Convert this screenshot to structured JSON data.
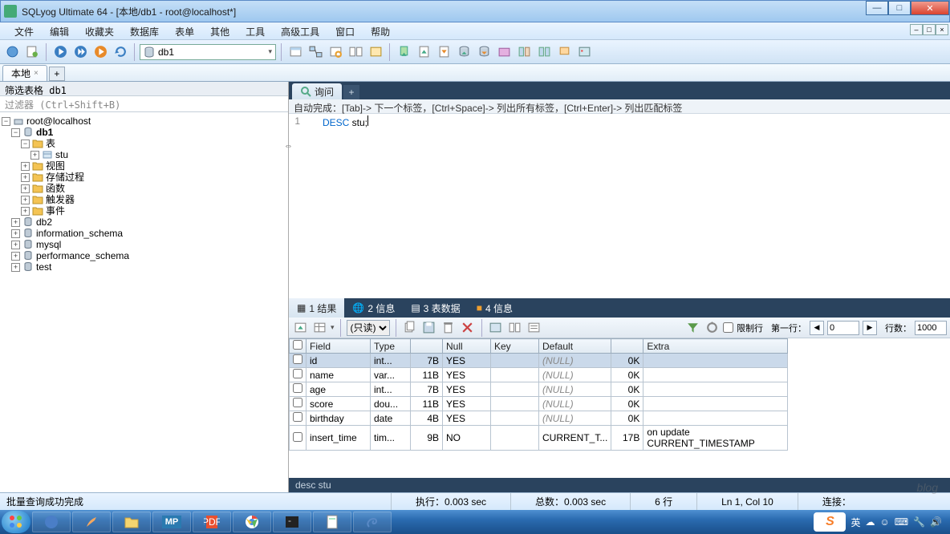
{
  "window": {
    "title": "SQLyog Ultimate 64 - [本地/db1 - root@localhost*]"
  },
  "menu": {
    "items": [
      "文件",
      "编辑",
      "收藏夹",
      "数据库",
      "表单",
      "其他",
      "工具",
      "高级工具",
      "窗口",
      "帮助"
    ]
  },
  "toolbar": {
    "db_selected": "db1"
  },
  "conn_tabs": {
    "items": [
      "本地"
    ]
  },
  "sidebar": {
    "filter_header": "筛选表格 db1",
    "filter_placeholder": "过滤器 (Ctrl+Shift+B)",
    "root": "root@localhost",
    "db1": {
      "name": "db1",
      "tables_label": "表",
      "table_items": [
        "stu"
      ],
      "folders": [
        "视图",
        "存储过程",
        "函数",
        "触发器",
        "事件"
      ]
    },
    "others": [
      "db2",
      "information_schema",
      "mysql",
      "performance_schema",
      "test"
    ]
  },
  "query_tabs": {
    "items": [
      "询问"
    ]
  },
  "editor": {
    "hint": "自动完成：[Tab]-> 下一个标签，[Ctrl+Space]-> 列出所有标签，[Ctrl+Enter]-> 列出匹配标签",
    "line_num": "1",
    "code_kw": "DESC",
    "code_rest": " stu;"
  },
  "result_tabs": {
    "items": [
      {
        "icon": "grid",
        "label": "1 结果"
      },
      {
        "icon": "globe",
        "label": "2 信息"
      },
      {
        "icon": "table",
        "label": "3 表数据"
      },
      {
        "icon": "info",
        "label": "4 信息"
      }
    ]
  },
  "result_toolbar": {
    "mode": "(只读)",
    "no_limit": "限制行",
    "first_row_lbl": "第一行：",
    "first_row": "0",
    "rows_lbl": "行数：",
    "rows": "1000"
  },
  "grid": {
    "headers": [
      "Field",
      "Type",
      "",
      "Null",
      "Key",
      "Default",
      "",
      "Extra"
    ],
    "rows": [
      {
        "Field": "id",
        "Type": "int...",
        "Len": "7B",
        "Null": "YES",
        "Key": "",
        "Default": "(NULL)",
        "DefLen": "0K",
        "Extra": ""
      },
      {
        "Field": "name",
        "Type": "var...",
        "Len": "11B",
        "Null": "YES",
        "Key": "",
        "Default": "(NULL)",
        "DefLen": "0K",
        "Extra": ""
      },
      {
        "Field": "age",
        "Type": "int...",
        "Len": "7B",
        "Null": "YES",
        "Key": "",
        "Default": "(NULL)",
        "DefLen": "0K",
        "Extra": ""
      },
      {
        "Field": "score",
        "Type": "dou...",
        "Len": "11B",
        "Null": "YES",
        "Key": "",
        "Default": "(NULL)",
        "DefLen": "0K",
        "Extra": ""
      },
      {
        "Field": "birthday",
        "Type": "date",
        "Len": "4B",
        "Null": "YES",
        "Key": "",
        "Default": "(NULL)",
        "DefLen": "0K",
        "Extra": ""
      },
      {
        "Field": "insert_time",
        "Type": "tim...",
        "Len": "9B",
        "Null": "NO",
        "Key": "",
        "Default": "CURRENT_T...",
        "DefLen": "17B",
        "Extra": "on update CURRENT_TIMESTAMP"
      }
    ]
  },
  "result_footer": "desc stu",
  "status": {
    "left": "批量查询成功完成",
    "exec": "执行：0.003 sec",
    "total": "总数：0.003 sec",
    "rows": "6 行",
    "cursor": "Ln 1, Col 10",
    "conn": "连接："
  },
  "tray": {
    "ime": "英",
    "sogou": "S"
  }
}
